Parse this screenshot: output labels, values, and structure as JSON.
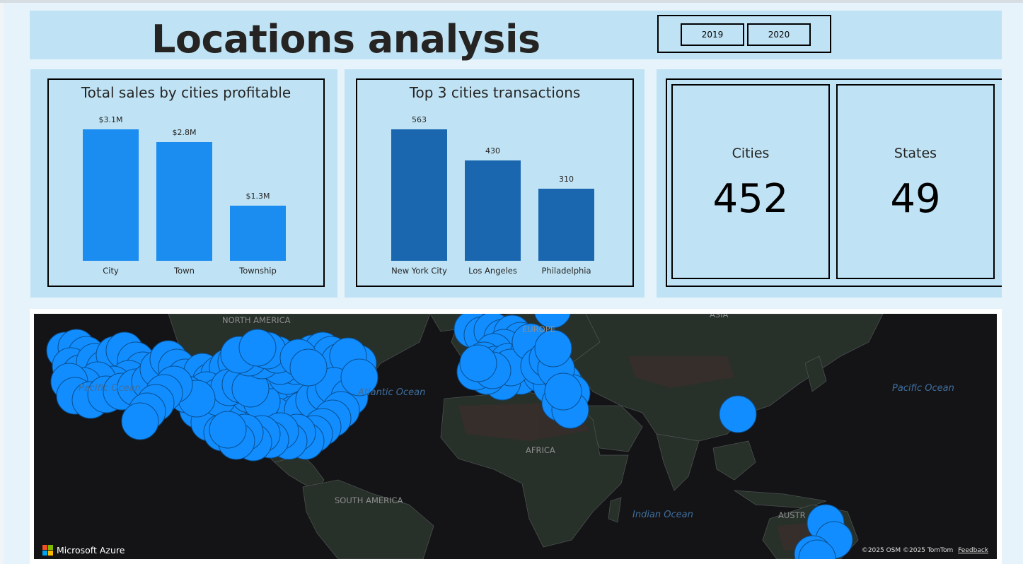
{
  "header": {
    "title": "Locations analysis",
    "year_slicer": {
      "options": [
        "2019",
        "2020"
      ]
    }
  },
  "sales_chart": {
    "title": "Total sales by cities profitable",
    "chart_data": {
      "type": "bar",
      "title": "Total sales by cities profitable",
      "categories": [
        "City",
        "Town",
        "Township"
      ],
      "values": [
        3.1,
        2.8,
        1.3
      ],
      "data_labels": [
        "$3.1M",
        "$2.8M",
        "$1.3M"
      ],
      "unit": "M",
      "ylim": [
        0,
        3.1
      ],
      "bar_color": "#1b8cf0",
      "grid": false
    }
  },
  "transactions_chart": {
    "title": "Top 3 cities transactions",
    "chart_data": {
      "type": "bar",
      "title": "Top 3 cities transactions",
      "categories": [
        "New York City",
        "Los Angeles",
        "Philadelphia"
      ],
      "values": [
        563,
        430,
        310
      ],
      "data_labels": [
        "563",
        "430",
        "310"
      ],
      "ylim": [
        0,
        563
      ],
      "bar_color": "#1a67b0",
      "grid": false
    }
  },
  "kpis": {
    "cities": {
      "label": "Cities",
      "value": "452"
    },
    "states": {
      "label": "States",
      "value": "49"
    }
  },
  "map": {
    "bubble_color": "#118dff",
    "ocean_labels": [
      "Pacific Ocean",
      "Atlantic Ocean",
      "Pacific Ocean",
      "Indian Ocean"
    ],
    "continent_labels": [
      "NORTH AMERICA",
      "EUROPE",
      "ASIA",
      "AFRICA",
      "SOUTH AMERICA",
      "AUSTR"
    ],
    "logo_text": "Microsoft Azure",
    "attribution": "©2025 OSM  ©2025 TomTom",
    "feedback_link": "Feedback",
    "ms_logo_colors": [
      "#f25022",
      "#7fba00",
      "#00a4ef",
      "#ffb900"
    ]
  }
}
